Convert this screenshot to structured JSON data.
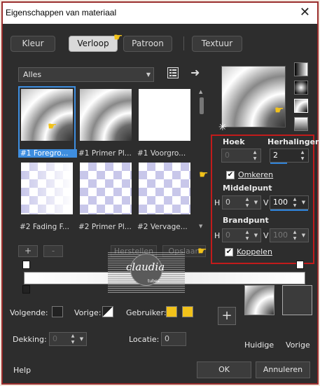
{
  "window": {
    "title": "Eigenschappen van materiaal",
    "close_label": "✕"
  },
  "tabs": [
    {
      "label": "Kleur"
    },
    {
      "label": "Verloop"
    },
    {
      "label": "Patroon"
    },
    {
      "label": "Textuur"
    }
  ],
  "category": {
    "selected": "Alles"
  },
  "thumbnails": [
    {
      "label": "#1 Foregro..."
    },
    {
      "label": "#1 Primer Pl..."
    },
    {
      "label": "#1 Voorgro..."
    },
    {
      "label": "#2 Fading F..."
    },
    {
      "label": "#2 Primer Pl..."
    },
    {
      "label": "#2 Vervage..."
    }
  ],
  "list_buttons": {
    "add": "+",
    "remove": "-",
    "restore": "Herstellen",
    "save": "Opslaan"
  },
  "angle": {
    "label": "Hoek",
    "value": "0"
  },
  "repeats": {
    "label": "Herhalingen",
    "value": "2"
  },
  "reverse": {
    "label": "Omkeren",
    "checked": true
  },
  "center": {
    "label": "Middelpunt",
    "h_label": "H",
    "h_value": "0",
    "v_label": "V",
    "v_value": "100"
  },
  "focus": {
    "label": "Brandpunt",
    "h_label": "H",
    "h_value": "0",
    "v_label": "V",
    "v_value": "100"
  },
  "link": {
    "label": "Koppelen",
    "checked": true
  },
  "bottom": {
    "next_label": "Volgende:",
    "prev_label": "Vorige:",
    "user_label": "Gebruiker:",
    "opacity_label": "Dekking:",
    "opacity_value": "0",
    "location_label": "Locatie:",
    "location_value": "0",
    "add_label": "+",
    "current_label": "Huidige",
    "previous_label": "Vorige"
  },
  "footer": {
    "help": "Help",
    "ok": "OK",
    "cancel": "Annuleren"
  },
  "watermark": {
    "name": "claudia"
  },
  "colors": {
    "accent": "#3e8ee0",
    "highlight": "#c21b1b",
    "user_swatch": "#f2c21a",
    "bg": "#2d2d2d"
  }
}
